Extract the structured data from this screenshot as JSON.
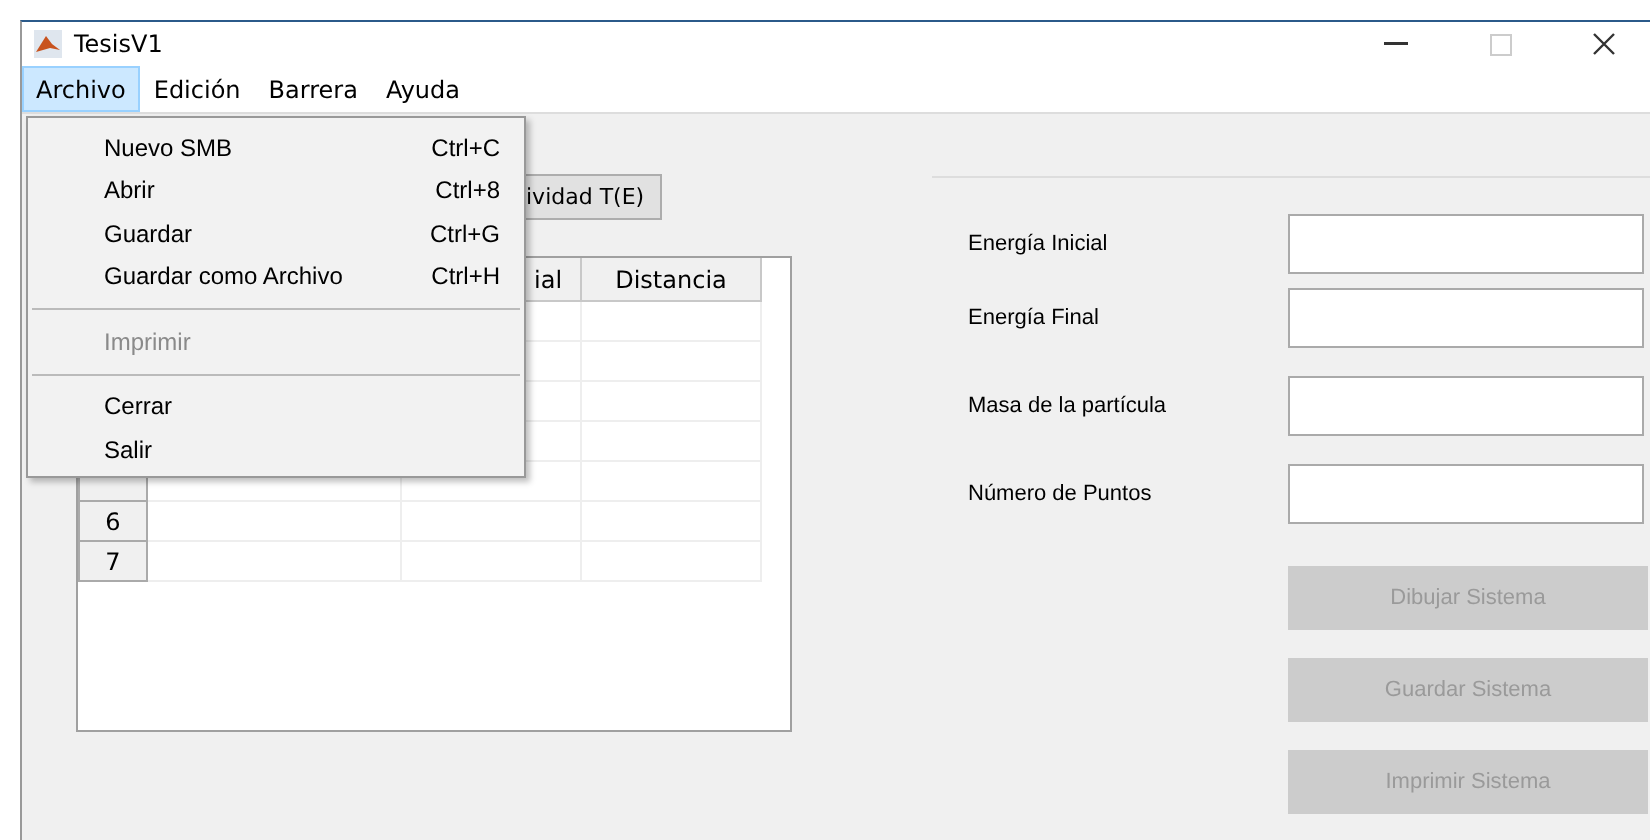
{
  "window": {
    "title": "TesisV1"
  },
  "menubar": [
    {
      "label": "Archivo",
      "selected": true
    },
    {
      "label": "Edición",
      "selected": false
    },
    {
      "label": "Barrera",
      "selected": false
    },
    {
      "label": "Ayuda",
      "selected": false
    }
  ],
  "menu": {
    "items": [
      {
        "kind": "item",
        "label": "Nuevo SMB",
        "shortcut": "Ctrl+C",
        "disabled": false
      },
      {
        "kind": "item",
        "label": "Abrir",
        "shortcut": "Ctrl+8",
        "disabled": false
      },
      {
        "kind": "item",
        "label": "Guardar",
        "shortcut": "Ctrl+G",
        "disabled": false
      },
      {
        "kind": "item",
        "label": "Guardar como Archivo",
        "shortcut": "Ctrl+H",
        "disabled": false
      },
      {
        "kind": "separator"
      },
      {
        "kind": "item",
        "label": "Imprimir",
        "disabled": true
      },
      {
        "kind": "separator"
      },
      {
        "kind": "item",
        "label": "Cerrar",
        "disabled": false
      },
      {
        "kind": "item",
        "label": "Salir",
        "disabled": false
      }
    ]
  },
  "partial_button": {
    "label": "ividad T(E)"
  },
  "table": {
    "columns": [
      "ial",
      "Distancia"
    ],
    "row_headers": [
      "6",
      "7"
    ]
  },
  "fields": [
    {
      "label": "Energía Inicial"
    },
    {
      "label": "Energía Final"
    },
    {
      "label": "Masa de la partícula"
    },
    {
      "label": "Número de Puntos"
    }
  ],
  "buttons": [
    {
      "label": "Dibujar Sistema",
      "disabled": true
    },
    {
      "label": "Guardar Sistema",
      "disabled": true
    },
    {
      "label": "Imprimir Sistema",
      "disabled": true
    }
  ]
}
